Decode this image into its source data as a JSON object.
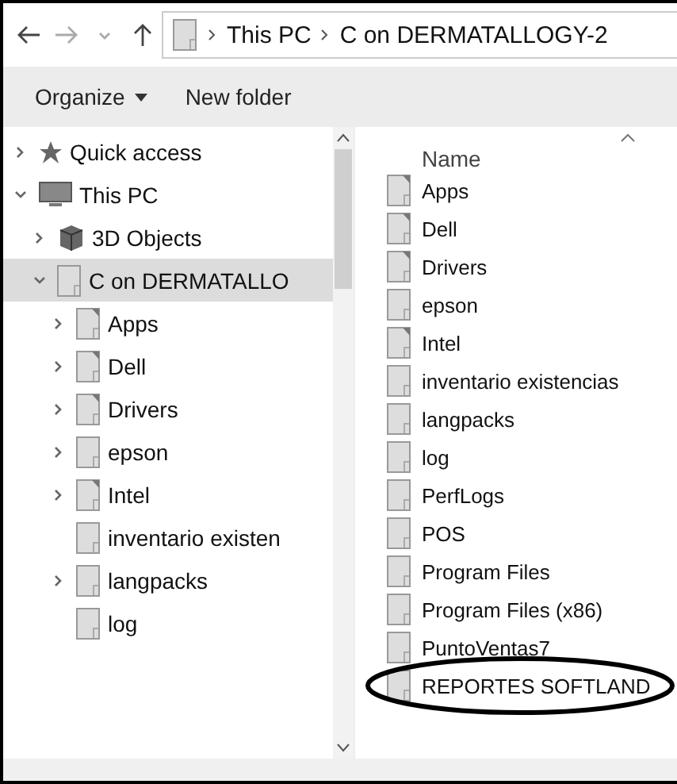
{
  "address_bar": {
    "segments": [
      "This PC",
      "C on DERMATALLOGY-2"
    ]
  },
  "toolbar": {
    "buttons": [
      {
        "label": "Organize",
        "dropdown": true
      },
      {
        "label": "New folder",
        "dropdown": false
      }
    ]
  },
  "navigation_pane": {
    "items": [
      {
        "label": "Quick access",
        "kind": "star",
        "expandable": true,
        "expanded": false,
        "selected": false
      },
      {
        "label": "This PC",
        "kind": "computer",
        "expandable": true,
        "expanded": true,
        "selected": false,
        "children": [
          {
            "label": "3D Objects",
            "kind": "cube",
            "expandable": true,
            "expanded": false,
            "selected": false
          },
          {
            "label": "C on DERMATALLO",
            "kind": "drive",
            "expandable": true,
            "expanded": true,
            "selected": true,
            "children": [
              {
                "label": "Apps",
                "kind": "flagged",
                "expandable": true,
                "expanded": false,
                "selected": false
              },
              {
                "label": "Dell",
                "kind": "flagged",
                "expandable": true,
                "expanded": false,
                "selected": false
              },
              {
                "label": "Drivers",
                "kind": "flagged",
                "expandable": true,
                "expanded": false,
                "selected": false
              },
              {
                "label": "epson",
                "kind": "plain",
                "expandable": true,
                "expanded": false,
                "selected": false
              },
              {
                "label": "Intel",
                "kind": "flagged",
                "expandable": true,
                "expanded": false,
                "selected": false
              },
              {
                "label": "inventario existen",
                "kind": "plain",
                "expandable": false,
                "expanded": false,
                "selected": false
              },
              {
                "label": "langpacks",
                "kind": "plain",
                "expandable": true,
                "expanded": false,
                "selected": false
              },
              {
                "label": "log",
                "kind": "plain",
                "expandable": false,
                "expanded": false,
                "selected": false
              }
            ]
          }
        ]
      }
    ]
  },
  "file_list": {
    "column": "Name",
    "items": [
      {
        "name": "Apps",
        "kind": "flagged",
        "circled": false
      },
      {
        "name": "Dell",
        "kind": "flagged",
        "circled": false
      },
      {
        "name": "Drivers",
        "kind": "flagged",
        "circled": false
      },
      {
        "name": "epson",
        "kind": "plain",
        "circled": false
      },
      {
        "name": "Intel",
        "kind": "flagged",
        "circled": false
      },
      {
        "name": "inventario existencias",
        "kind": "plain",
        "circled": false
      },
      {
        "name": "langpacks",
        "kind": "plain",
        "circled": false
      },
      {
        "name": "log",
        "kind": "plain",
        "circled": false
      },
      {
        "name": "PerfLogs",
        "kind": "plain",
        "circled": false
      },
      {
        "name": "POS",
        "kind": "plain",
        "circled": false
      },
      {
        "name": "Program Files",
        "kind": "plain",
        "circled": false
      },
      {
        "name": "Program Files (x86)",
        "kind": "plain",
        "circled": false
      },
      {
        "name": "PuntoVentas7",
        "kind": "plain",
        "circled": false
      },
      {
        "name": "REPORTES SOFTLAND",
        "kind": "plain",
        "circled": true
      }
    ]
  }
}
